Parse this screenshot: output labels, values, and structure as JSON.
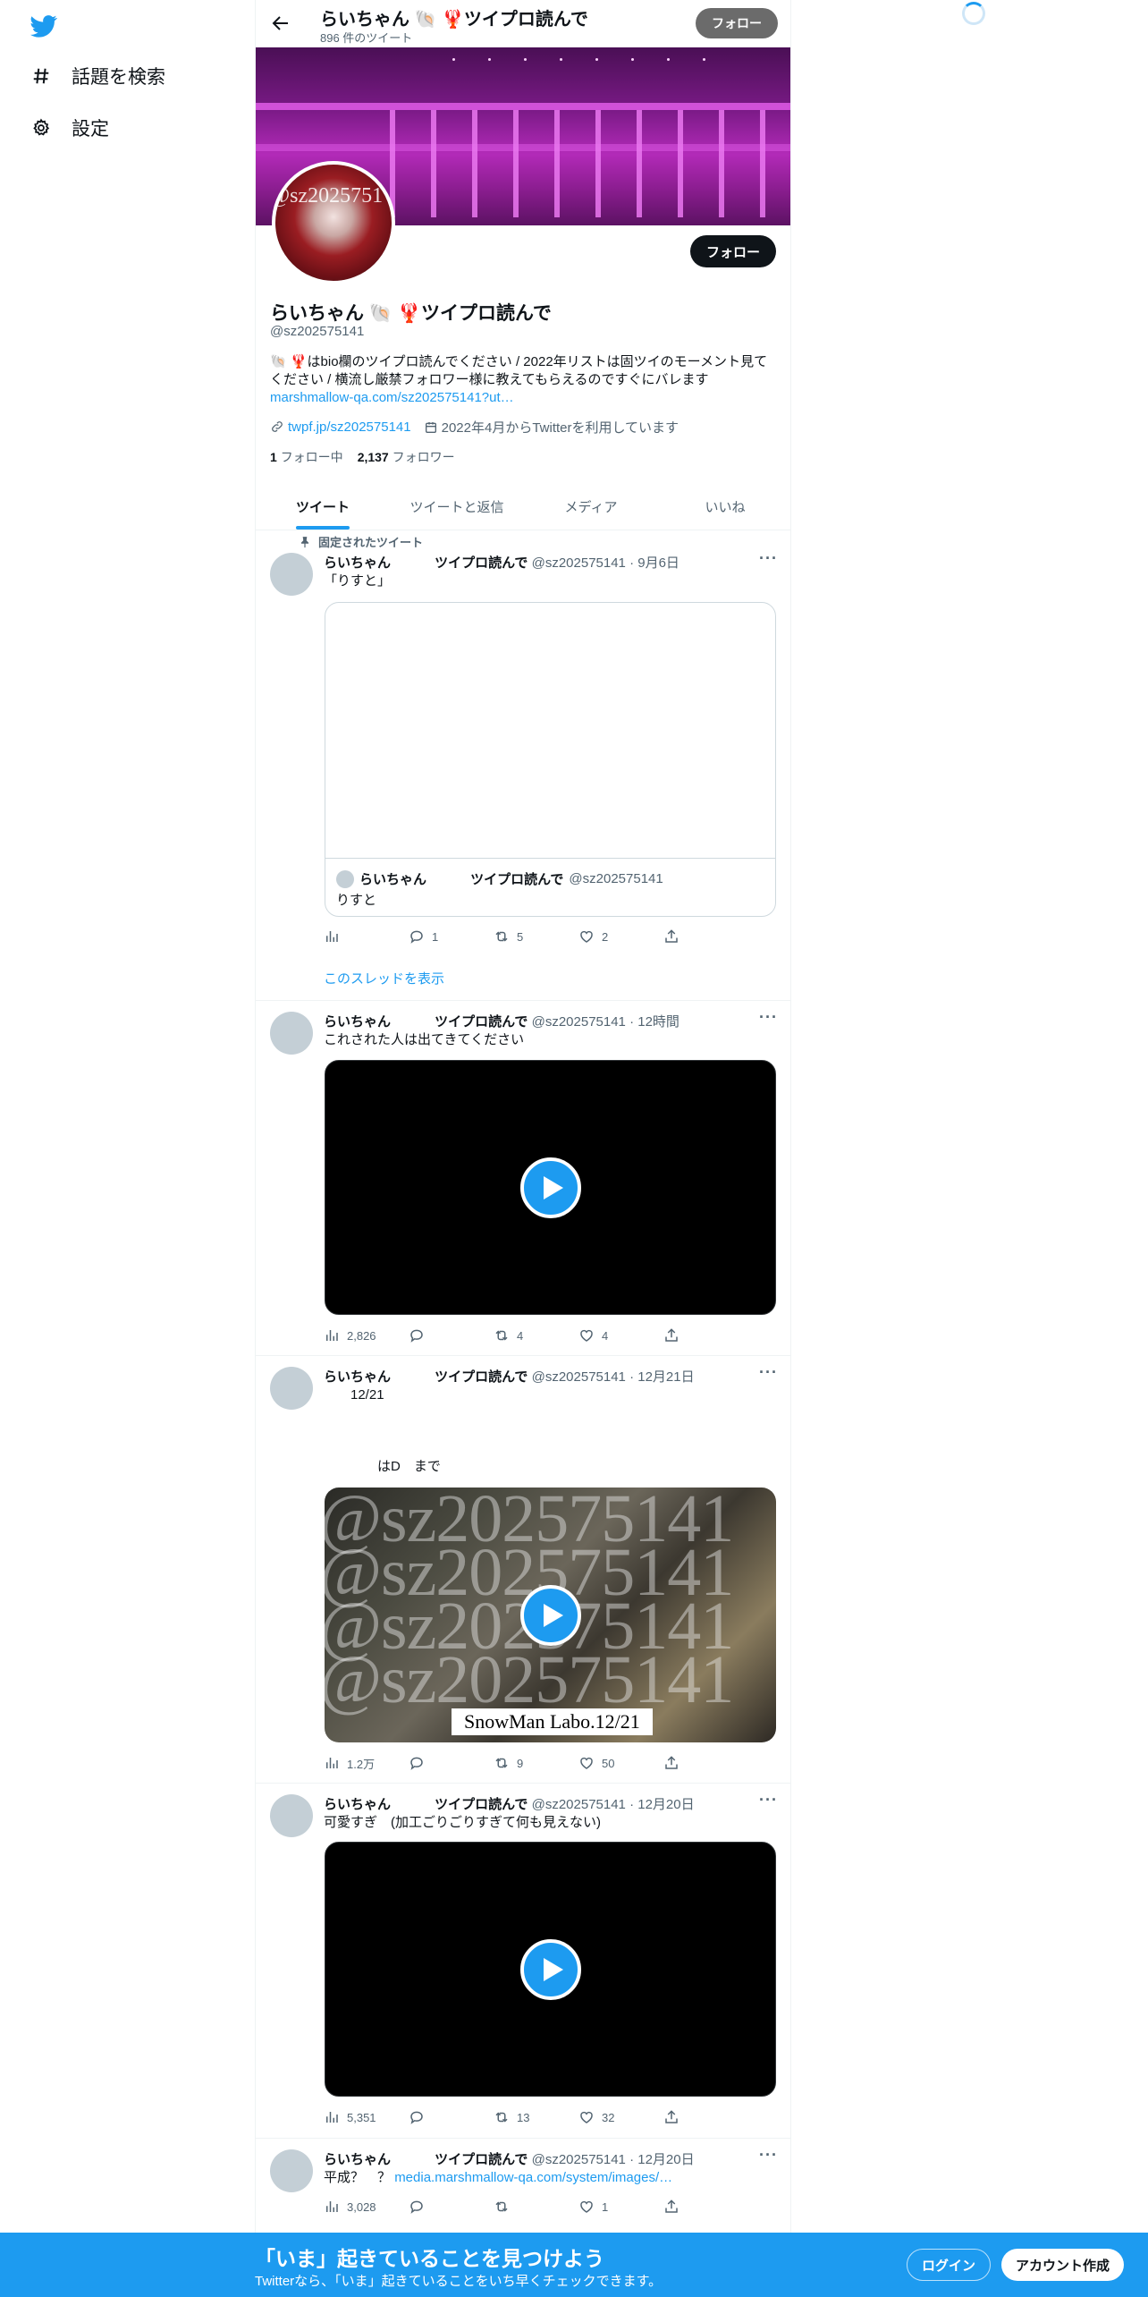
{
  "nav": {
    "explore_label": "話題を検索",
    "settings_label": "設定"
  },
  "header": {
    "title": "らいちゃん 🐚 🦞ツイプロ読んで",
    "tweet_count": "896 件のツイート",
    "follow_label": "フォロー"
  },
  "profile": {
    "follow_label": "フォロー",
    "avatar_watermark": "@sz2025751",
    "name": "らいちゃん 🐚 🦞ツイプロ読んで",
    "handle": "@sz202575141",
    "bio_text": "🐚 🦞はbio欄のツイプロ読んでください / 2022年リストは固ツイのモーメント見てください / 横流し厳禁フォロワー様に教えてもらえるのですぐにバレます",
    "bio_link": "marshmallow-qa.com/sz202575141?ut…",
    "website": "twpf.jp/sz202575141",
    "joined": "2022年4月からTwitterを利用しています",
    "following_count": "1",
    "following_label": "フォロー中",
    "followers_count": "2,137",
    "followers_label": "フォロワー"
  },
  "tabs": [
    "ツイート",
    "ツイートと返信",
    "メディア",
    "いいね"
  ],
  "pinned_label": "固定されたツイート",
  "tweets": [
    {
      "name": "らいちゃん 　　　ツイプロ読んで",
      "meta": "@sz202575141 · 9月6日",
      "text": "「りすと」",
      "quote_name": "らいちゃん 　　　ツイプロ読んで",
      "quote_handle": "@sz202575141",
      "quote_text": "りすと",
      "views": "",
      "replies": "1",
      "retweets": "5",
      "likes": "2",
      "thread_link": "このスレッドを表示"
    },
    {
      "name": "らいちゃん 　　　ツイプロ読んで",
      "meta": "@sz202575141 · 12時間",
      "text": "これされた人は出てきてください",
      "views": "2,826",
      "replies": "",
      "retweets": "4",
      "likes": "4"
    },
    {
      "name": "らいちゃん 　　　ツイプロ読んで",
      "meta": "@sz202575141 · 12月21日",
      "text": "　　12/21",
      "text2": "　　　　はD　まで",
      "media_watermark": "@sz202575141",
      "media_caption": "SnowMan Labo.12/21",
      "views": "1.2万",
      "replies": "",
      "retweets": "9",
      "likes": "50"
    },
    {
      "name": "らいちゃん 　　　ツイプロ読んで",
      "meta": "@sz202575141 · 12月20日",
      "text": "可愛すぎ　(加工ごりごりすぎて何も見えない)",
      "views": "5,351",
      "replies": "",
      "retweets": "13",
      "likes": "32"
    },
    {
      "name": "らいちゃん 　　　ツイプロ読んで",
      "meta": "@sz202575141 · 12月20日",
      "text": "平成？　？",
      "link": "media.marshmallow-qa.com/system/images/…",
      "views": "3,028",
      "replies": "",
      "retweets": "",
      "likes": "1"
    }
  ],
  "bottom_bar": {
    "title": "「いま」起きていることを見つけよう",
    "subtitle": "Twitterなら、「いま」起きていることをいち早くチェックできます。",
    "login_label": "ログイン",
    "signup_label": "アカウント作成"
  },
  "colors": {
    "accent": "#1d9bf0",
    "text": "#0f1419",
    "muted": "#536471"
  }
}
